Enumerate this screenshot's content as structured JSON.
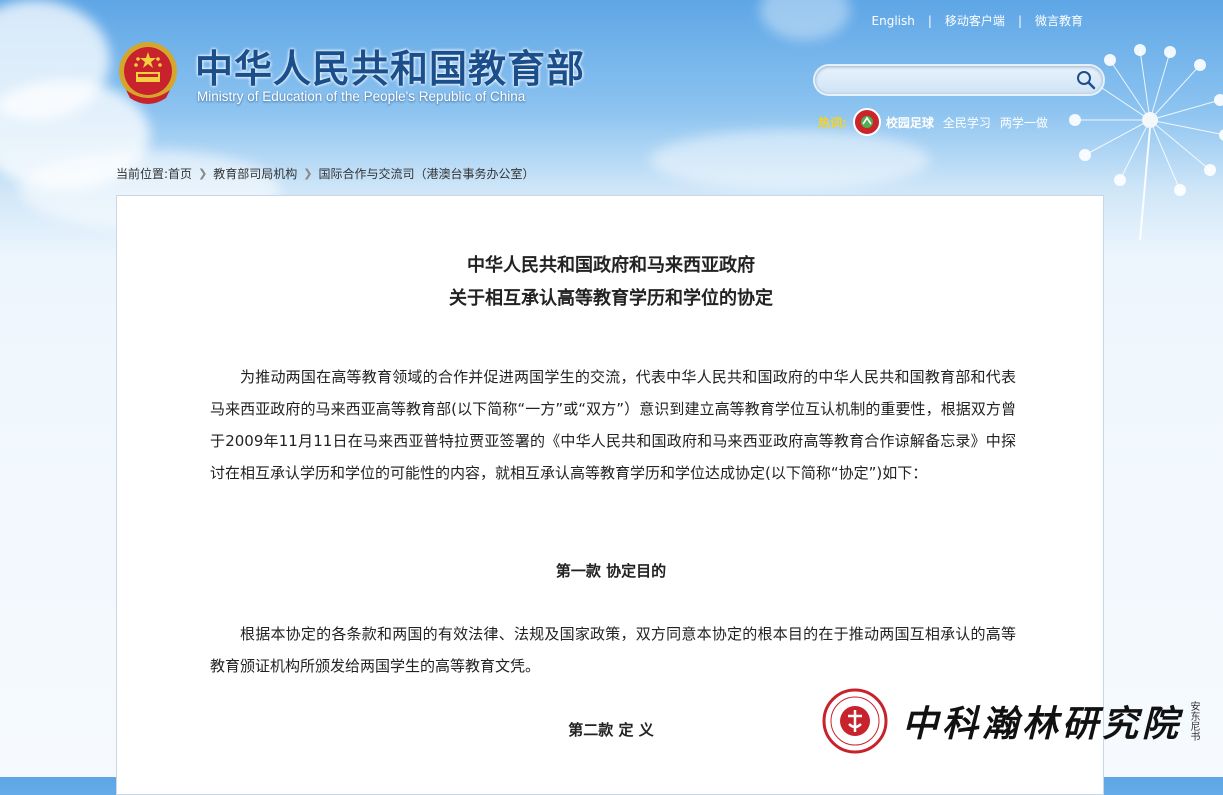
{
  "header": {
    "site_title": "中华人民共和国教育部",
    "site_subtitle": "Ministry of Education of the People's Republic of China",
    "top_links": [
      "English",
      "移动客户端",
      "微言教育"
    ],
    "top_sep": "|",
    "search": {
      "placeholder": "",
      "value": ""
    },
    "hot": {
      "label": "热词:",
      "items": [
        "校园足球",
        "全民学习",
        "两学一做"
      ]
    }
  },
  "breadcrumb": {
    "prefix": "当前位置:",
    "items": [
      "首页",
      "教育部司局机构",
      "国际合作与交流司（港澳台事务办公室）"
    ]
  },
  "article": {
    "title_line1": "中华人民共和国政府和马来西亚政府",
    "title_line2": "关于相互承认高等教育学历和学位的协定",
    "intro": "为推动两国在高等教育领域的合作并促进两国学生的交流，代表中华人民共和国政府的中华人民共和国教育部和代表马来西亚政府的马来西亚高等教育部(以下简称“一方”或“双方”）意识到建立高等教育学位互认机制的重要性，根据双方曾于2009年11月11日在马来西亚普特拉贾亚签署的《中华人民共和国政府和马来西亚政府高等教育合作谅解备忘录》中探讨在相互承认学历和学位的可能性的内容，就相互承认高等教育学历和学位达成协定(以下简称“协定”)如下：",
    "section1_heading": "第一款 协定目的",
    "section1_text": "根据本协定的各条款和两国的有效法律、法规及国家政策，双方同意本协定的根本目的在于推动两国互相承认的高等教育颁证机构所颁发给两国学生的高等教育文凭。",
    "section2_heading": "第二款 定 义"
  },
  "watermark": {
    "text": "中科瀚林研究院",
    "side": "安东尼书"
  },
  "colors": {
    "title_blue": "#1b4f8c",
    "hot_label": "#f3d22b",
    "badge_red": "#c9252b"
  }
}
